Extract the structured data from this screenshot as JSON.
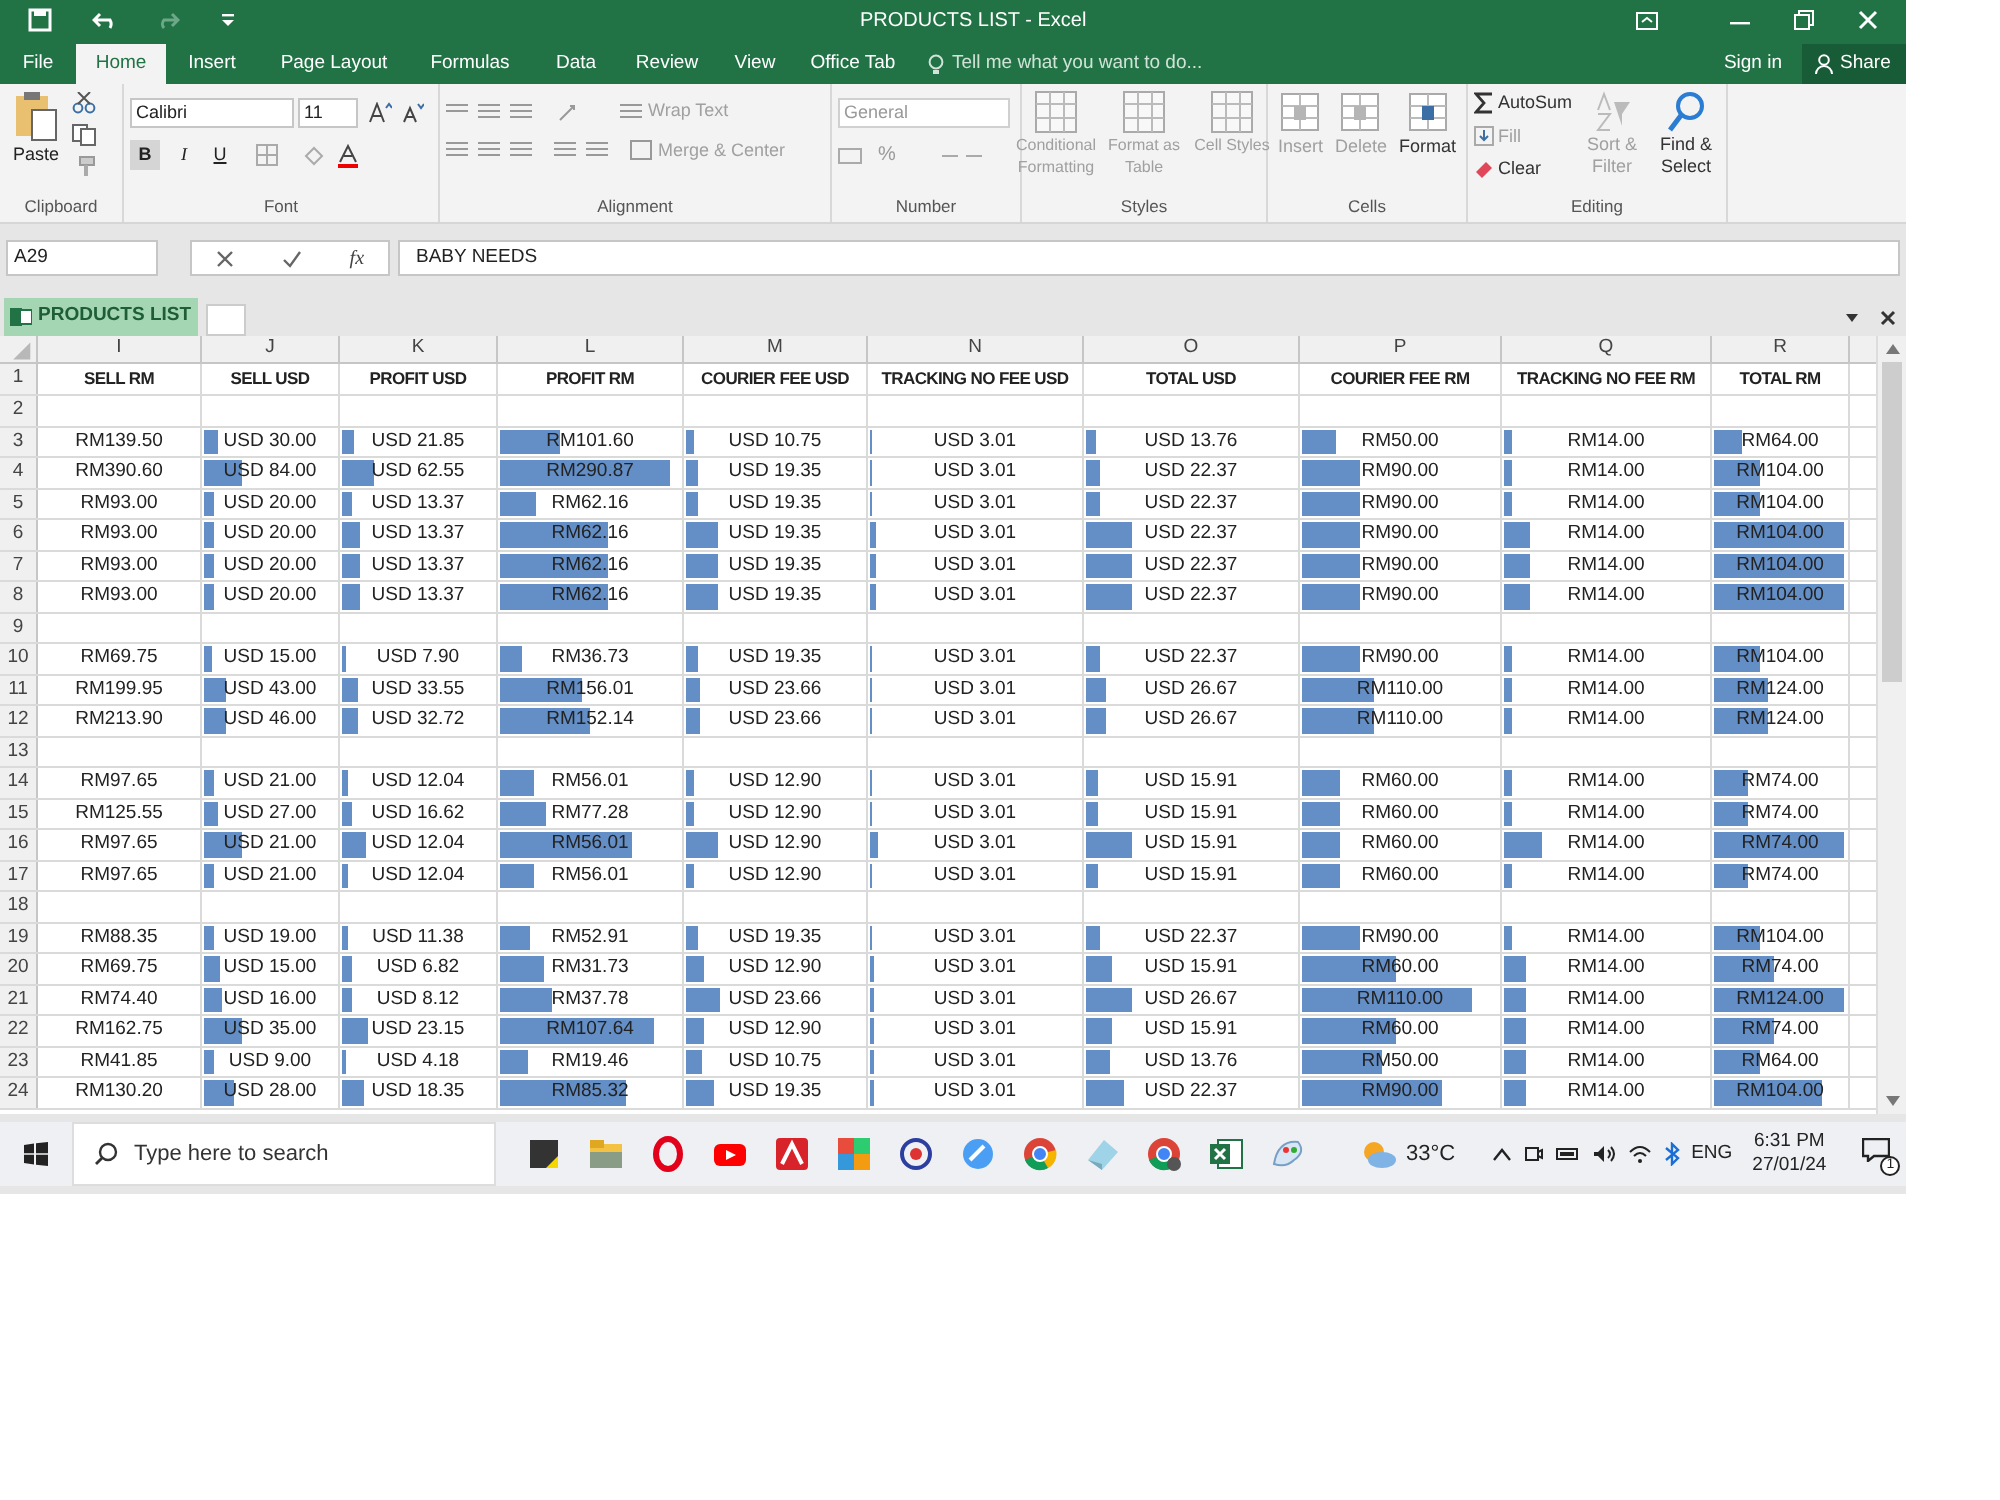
{
  "window": {
    "title": "PRODUCTS LIST - Excel"
  },
  "ribbon_tabs": [
    {
      "label": "File",
      "selected": false
    },
    {
      "label": "Home",
      "selected": true
    },
    {
      "label": "Insert",
      "selected": false
    },
    {
      "label": "Page Layout",
      "selected": false
    },
    {
      "label": "Formulas",
      "selected": false
    },
    {
      "label": "Data",
      "selected": false
    },
    {
      "label": "Review",
      "selected": false
    },
    {
      "label": "View",
      "selected": false
    },
    {
      "label": "Office Tab",
      "selected": false
    }
  ],
  "tell_me": {
    "placeholder": "Tell me what you want to do..."
  },
  "account": {
    "sign_in": "Sign in",
    "share": "Share"
  },
  "clipboard": {
    "label": "Clipboard",
    "paste": "Paste"
  },
  "font": {
    "label": "Font",
    "font_name": "Calibri",
    "font_size": "11",
    "bold": "B",
    "italic": "I",
    "underline": "U"
  },
  "alignment": {
    "label": "Alignment",
    "wrap": "Wrap Text",
    "merge": "Merge & Center"
  },
  "number": {
    "label": "Number",
    "format": "General",
    "percent": "%"
  },
  "styles": {
    "label": "Styles",
    "buttons": [
      {
        "label": "Conditional Formatting",
        "disabled": true
      },
      {
        "label": "Format as Table",
        "disabled": true
      },
      {
        "label": "Cell Styles",
        "disabled": true
      }
    ]
  },
  "cells": {
    "label": "Cells",
    "buttons": [
      {
        "label": "Insert",
        "disabled": true
      },
      {
        "label": "Delete",
        "disabled": true
      },
      {
        "label": "Format",
        "disabled": false
      }
    ]
  },
  "editing": {
    "label": "Editing",
    "items": [
      {
        "label": "AutoSum",
        "disabled": false
      },
      {
        "label": "Fill",
        "disabled": true
      },
      {
        "label": "Clear",
        "disabled": false
      }
    ],
    "sort": {
      "label": "Sort & Filter",
      "disabled": true
    },
    "find": {
      "label": "Find & Select",
      "disabled": false
    }
  },
  "formula_bar": {
    "name_box": "A29",
    "fx": "fx",
    "formula": "BABY NEEDS"
  },
  "document_tab": {
    "label": "PRODUCTS LIST"
  },
  "sheet": {
    "columns": [
      "I",
      "J",
      "K",
      "L",
      "M",
      "N",
      "O",
      "P",
      "Q",
      "R"
    ],
    "header_row": {
      "number": "1",
      "cells": [
        "SELL RM",
        "SELL USD",
        "PROFIT USD",
        "PROFIT RM",
        "COURIER FEE USD",
        "TRACKING NO FEE USD",
        "TOTAL USD",
        "COURIER FEE RM",
        "TRACKING NO FEE RM",
        "TOTAL RM"
      ]
    },
    "rows": [
      {
        "number": "2"
      },
      {
        "number": "3",
        "cells": [
          {
            "text": "RM139.50"
          },
          {
            "text": "USD 30.00",
            "level": 0.11
          },
          {
            "text": "USD 21.85",
            "level": 0.08
          },
          {
            "text": "RM101.60",
            "level": 0.33
          },
          {
            "text": "USD 10.75",
            "level": 0.04
          },
          {
            "text": "USD 3.01",
            "level": 0.01
          },
          {
            "text": "USD 13.76",
            "level": 0.05
          },
          {
            "text": "RM50.00",
            "level": 0.17
          },
          {
            "text": "RM14.00",
            "level": 0.04
          },
          {
            "text": "RM64.00",
            "level": 0.21
          }
        ]
      },
      {
        "number": "4",
        "cells": [
          {
            "text": "RM390.60"
          },
          {
            "text": "USD 84.00",
            "level": 0.28
          },
          {
            "text": "USD 62.55",
            "level": 0.21
          },
          {
            "text": "RM290.87",
            "level": 0.93
          },
          {
            "text": "USD 19.35",
            "level": 0.07
          },
          {
            "text": "USD 3.01",
            "level": 0.01
          },
          {
            "text": "USD 22.37",
            "level": 0.07
          },
          {
            "text": "RM90.00",
            "level": 0.29
          },
          {
            "text": "RM14.00",
            "level": 0.04
          },
          {
            "text": "RM104.00",
            "level": 0.34
          }
        ]
      },
      {
        "number": "5",
        "cells": [
          {
            "text": "RM93.00"
          },
          {
            "text": "USD 20.00",
            "level": 0.08
          },
          {
            "text": "USD 13.37",
            "level": 0.06
          },
          {
            "text": "RM62.16",
            "level": 0.2
          },
          {
            "text": "USD 19.35",
            "level": 0.07
          },
          {
            "text": "USD 3.01",
            "level": 0.01
          },
          {
            "text": "USD 22.37",
            "level": 0.07
          },
          {
            "text": "RM90.00",
            "level": 0.29
          },
          {
            "text": "RM14.00",
            "level": 0.04
          },
          {
            "text": "RM104.00",
            "level": 0.34
          }
        ]
      },
      {
        "number": "6",
        "cells": [
          {
            "text": "RM93.00"
          },
          {
            "text": "USD 20.00",
            "level": 0.08
          },
          {
            "text": "USD 13.37",
            "level": 0.12
          },
          {
            "text": "RM62.16",
            "level": 0.59
          },
          {
            "text": "USD 19.35",
            "level": 0.18
          },
          {
            "text": "USD 3.01",
            "level": 0.03
          },
          {
            "text": "USD 22.37",
            "level": 0.22
          },
          {
            "text": "RM90.00",
            "level": 0.29
          },
          {
            "text": "RM14.00",
            "level": 0.13
          },
          {
            "text": "RM104.00",
            "level": 0.97
          }
        ]
      },
      {
        "number": "7",
        "cells": [
          {
            "text": "RM93.00"
          },
          {
            "text": "USD 20.00",
            "level": 0.08
          },
          {
            "text": "USD 13.37",
            "level": 0.12
          },
          {
            "text": "RM62.16",
            "level": 0.59
          },
          {
            "text": "USD 19.35",
            "level": 0.18
          },
          {
            "text": "USD 3.01",
            "level": 0.03
          },
          {
            "text": "USD 22.37",
            "level": 0.22
          },
          {
            "text": "RM90.00",
            "level": 0.29
          },
          {
            "text": "RM14.00",
            "level": 0.13
          },
          {
            "text": "RM104.00",
            "level": 0.97
          }
        ]
      },
      {
        "number": "8",
        "cells": [
          {
            "text": "RM93.00"
          },
          {
            "text": "USD 20.00",
            "level": 0.08
          },
          {
            "text": "USD 13.37",
            "level": 0.12
          },
          {
            "text": "RM62.16",
            "level": 0.59
          },
          {
            "text": "USD 19.35",
            "level": 0.18
          },
          {
            "text": "USD 3.01",
            "level": 0.03
          },
          {
            "text": "USD 22.37",
            "level": 0.22
          },
          {
            "text": "RM90.00",
            "level": 0.29
          },
          {
            "text": "RM14.00",
            "level": 0.13
          },
          {
            "text": "RM104.00",
            "level": 0.97
          }
        ]
      },
      {
        "number": "9"
      },
      {
        "number": "10",
        "cells": [
          {
            "text": "RM69.75"
          },
          {
            "text": "USD 15.00",
            "level": 0.06
          },
          {
            "text": "USD 7.90",
            "level": 0.03
          },
          {
            "text": "RM36.73",
            "level": 0.12
          },
          {
            "text": "USD 19.35",
            "level": 0.07
          },
          {
            "text": "USD 3.01",
            "level": 0.01
          },
          {
            "text": "USD 22.37",
            "level": 0.07
          },
          {
            "text": "RM90.00",
            "level": 0.29
          },
          {
            "text": "RM14.00",
            "level": 0.04
          },
          {
            "text": "RM104.00",
            "level": 0.34
          }
        ]
      },
      {
        "number": "11",
        "cells": [
          {
            "text": "RM199.95"
          },
          {
            "text": "USD 43.00",
            "level": 0.16
          },
          {
            "text": "USD 33.55",
            "level": 0.11
          },
          {
            "text": "RM156.01",
            "level": 0.45
          },
          {
            "text": "USD 23.66",
            "level": 0.08
          },
          {
            "text": "USD 3.01",
            "level": 0.01
          },
          {
            "text": "USD 26.67",
            "level": 0.09
          },
          {
            "text": "RM110.00",
            "level": 0.36
          },
          {
            "text": "RM14.00",
            "level": 0.04
          },
          {
            "text": "RM124.00",
            "level": 0.41
          }
        ]
      },
      {
        "number": "12",
        "cells": [
          {
            "text": "RM213.90"
          },
          {
            "text": "USD 46.00",
            "level": 0.17
          },
          {
            "text": "USD 32.72",
            "level": 0.11
          },
          {
            "text": "RM152.14",
            "level": 0.49
          },
          {
            "text": "USD 23.66",
            "level": 0.08
          },
          {
            "text": "USD 3.01",
            "level": 0.01
          },
          {
            "text": "USD 26.67",
            "level": 0.09
          },
          {
            "text": "RM110.00",
            "level": 0.36
          },
          {
            "text": "RM14.00",
            "level": 0.04
          },
          {
            "text": "RM124.00",
            "level": 0.41
          }
        ]
      },
      {
        "number": "13"
      },
      {
        "number": "14",
        "cells": [
          {
            "text": "RM97.65"
          },
          {
            "text": "USD 21.00",
            "level": 0.08
          },
          {
            "text": "USD 12.04",
            "level": 0.04
          },
          {
            "text": "RM56.01",
            "level": 0.19
          },
          {
            "text": "USD 12.90",
            "level": 0.04
          },
          {
            "text": "USD 3.01",
            "level": 0.01
          },
          {
            "text": "USD 15.91",
            "level": 0.06
          },
          {
            "text": "RM60.00",
            "level": 0.19
          },
          {
            "text": "RM14.00",
            "level": 0.04
          },
          {
            "text": "RM74.00",
            "level": 0.25
          }
        ]
      },
      {
        "number": "15",
        "cells": [
          {
            "text": "RM125.55"
          },
          {
            "text": "USD 27.00",
            "level": 0.1
          },
          {
            "text": "USD 16.62",
            "level": 0.06
          },
          {
            "text": "RM77.28",
            "level": 0.25
          },
          {
            "text": "USD 12.90",
            "level": 0.04
          },
          {
            "text": "USD 3.01",
            "level": 0.01
          },
          {
            "text": "USD 15.91",
            "level": 0.06
          },
          {
            "text": "RM60.00",
            "level": 0.19
          },
          {
            "text": "RM14.00",
            "level": 0.04
          },
          {
            "text": "RM74.00",
            "level": 0.25
          }
        ]
      },
      {
        "number": "16",
        "cells": [
          {
            "text": "RM97.65"
          },
          {
            "text": "USD 21.00",
            "level": 0.29
          },
          {
            "text": "USD 12.04",
            "level": 0.16
          },
          {
            "text": "RM56.01",
            "level": 0.73
          },
          {
            "text": "USD 12.90",
            "level": 0.18
          },
          {
            "text": "USD 3.01",
            "level": 0.04
          },
          {
            "text": "USD 15.91",
            "level": 0.22
          },
          {
            "text": "RM60.00",
            "level": 0.19
          },
          {
            "text": "RM14.00",
            "level": 0.18
          },
          {
            "text": "RM74.00",
            "level": 0.97
          }
        ]
      },
      {
        "number": "17",
        "cells": [
          {
            "text": "RM97.65"
          },
          {
            "text": "USD 21.00",
            "level": 0.08
          },
          {
            "text": "USD 12.04",
            "level": 0.04
          },
          {
            "text": "RM56.01",
            "level": 0.19
          },
          {
            "text": "USD 12.90",
            "level": 0.04
          },
          {
            "text": "USD 3.01",
            "level": 0.01
          },
          {
            "text": "USD 15.91",
            "level": 0.06
          },
          {
            "text": "RM60.00",
            "level": 0.19
          },
          {
            "text": "RM14.00",
            "level": 0.04
          },
          {
            "text": "RM74.00",
            "level": 0.25
          }
        ]
      },
      {
        "number": "18"
      },
      {
        "number": "19",
        "cells": [
          {
            "text": "RM88.35"
          },
          {
            "text": "USD 19.00",
            "level": 0.07
          },
          {
            "text": "USD 11.38",
            "level": 0.04
          },
          {
            "text": "RM52.91",
            "level": 0.17
          },
          {
            "text": "USD 19.35",
            "level": 0.07
          },
          {
            "text": "USD 3.01",
            "level": 0.01
          },
          {
            "text": "USD 22.37",
            "level": 0.07
          },
          {
            "text": "RM90.00",
            "level": 0.29
          },
          {
            "text": "RM14.00",
            "level": 0.04
          },
          {
            "text": "RM104.00",
            "level": 0.34
          }
        ]
      },
      {
        "number": "20",
        "cells": [
          {
            "text": "RM69.75"
          },
          {
            "text": "USD 15.00",
            "level": 0.12
          },
          {
            "text": "USD 6.82",
            "level": 0.06
          },
          {
            "text": "RM31.73",
            "level": 0.24
          },
          {
            "text": "USD 12.90",
            "level": 0.1
          },
          {
            "text": "USD 3.01",
            "level": 0.02
          },
          {
            "text": "USD 15.91",
            "level": 0.12
          },
          {
            "text": "RM60.00",
            "level": 0.47
          },
          {
            "text": "RM14.00",
            "level": 0.11
          },
          {
            "text": "RM74.00",
            "level": 0.45
          }
        ]
      },
      {
        "number": "21",
        "cells": [
          {
            "text": "RM74.40"
          },
          {
            "text": "USD 16.00",
            "level": 0.13
          },
          {
            "text": "USD 8.12",
            "level": 0.06
          },
          {
            "text": "RM37.78",
            "level": 0.29
          },
          {
            "text": "USD 23.66",
            "level": 0.19
          },
          {
            "text": "USD 3.01",
            "level": 0.02
          },
          {
            "text": "USD 26.67",
            "level": 0.22
          },
          {
            "text": "RM110.00",
            "level": 0.86
          },
          {
            "text": "RM14.00",
            "level": 0.11
          },
          {
            "text": "RM124.00",
            "level": 0.97
          }
        ]
      },
      {
        "number": "22",
        "cells": [
          {
            "text": "RM162.75"
          },
          {
            "text": "USD 35.00",
            "level": 0.28
          },
          {
            "text": "USD 23.15",
            "level": 0.17
          },
          {
            "text": "RM107.64",
            "level": 0.85
          },
          {
            "text": "USD 12.90",
            "level": 0.1
          },
          {
            "text": "USD 3.01",
            "level": 0.02
          },
          {
            "text": "USD 15.91",
            "level": 0.12
          },
          {
            "text": "RM60.00",
            "level": 0.47
          },
          {
            "text": "RM14.00",
            "level": 0.11
          },
          {
            "text": "RM74.00",
            "level": 0.45
          }
        ]
      },
      {
        "number": "23",
        "cells": [
          {
            "text": "RM41.85"
          },
          {
            "text": "USD 9.00",
            "level": 0.08
          },
          {
            "text": "USD 4.18",
            "level": 0.03
          },
          {
            "text": "RM19.46",
            "level": 0.15
          },
          {
            "text": "USD 10.75",
            "level": 0.09
          },
          {
            "text": "USD 3.01",
            "level": 0.02
          },
          {
            "text": "USD 13.76",
            "level": 0.11
          },
          {
            "text": "RM50.00",
            "level": 0.4
          },
          {
            "text": "RM14.00",
            "level": 0.11
          },
          {
            "text": "RM64.00",
            "level": 0.35
          }
        ]
      },
      {
        "number": "24",
        "cells": [
          {
            "text": "RM130.20"
          },
          {
            "text": "USD 28.00",
            "level": 0.22
          },
          {
            "text": "USD 18.35",
            "level": 0.14
          },
          {
            "text": "RM85.32",
            "level": 0.69
          },
          {
            "text": "USD 19.35",
            "level": 0.15
          },
          {
            "text": "USD 3.01",
            "level": 0.02
          },
          {
            "text": "USD 22.37",
            "level": 0.18
          },
          {
            "text": "RM90.00",
            "level": 0.71
          },
          {
            "text": "RM14.00",
            "level": 0.11
          },
          {
            "text": "RM104.00",
            "level": 0.81
          }
        ]
      }
    ]
  },
  "taskbar": {
    "search_placeholder": "Type here to search",
    "temperature": "33°C",
    "language": "ENG",
    "time": "6:31 PM",
    "date": "27/01/24",
    "notifications": "1"
  }
}
